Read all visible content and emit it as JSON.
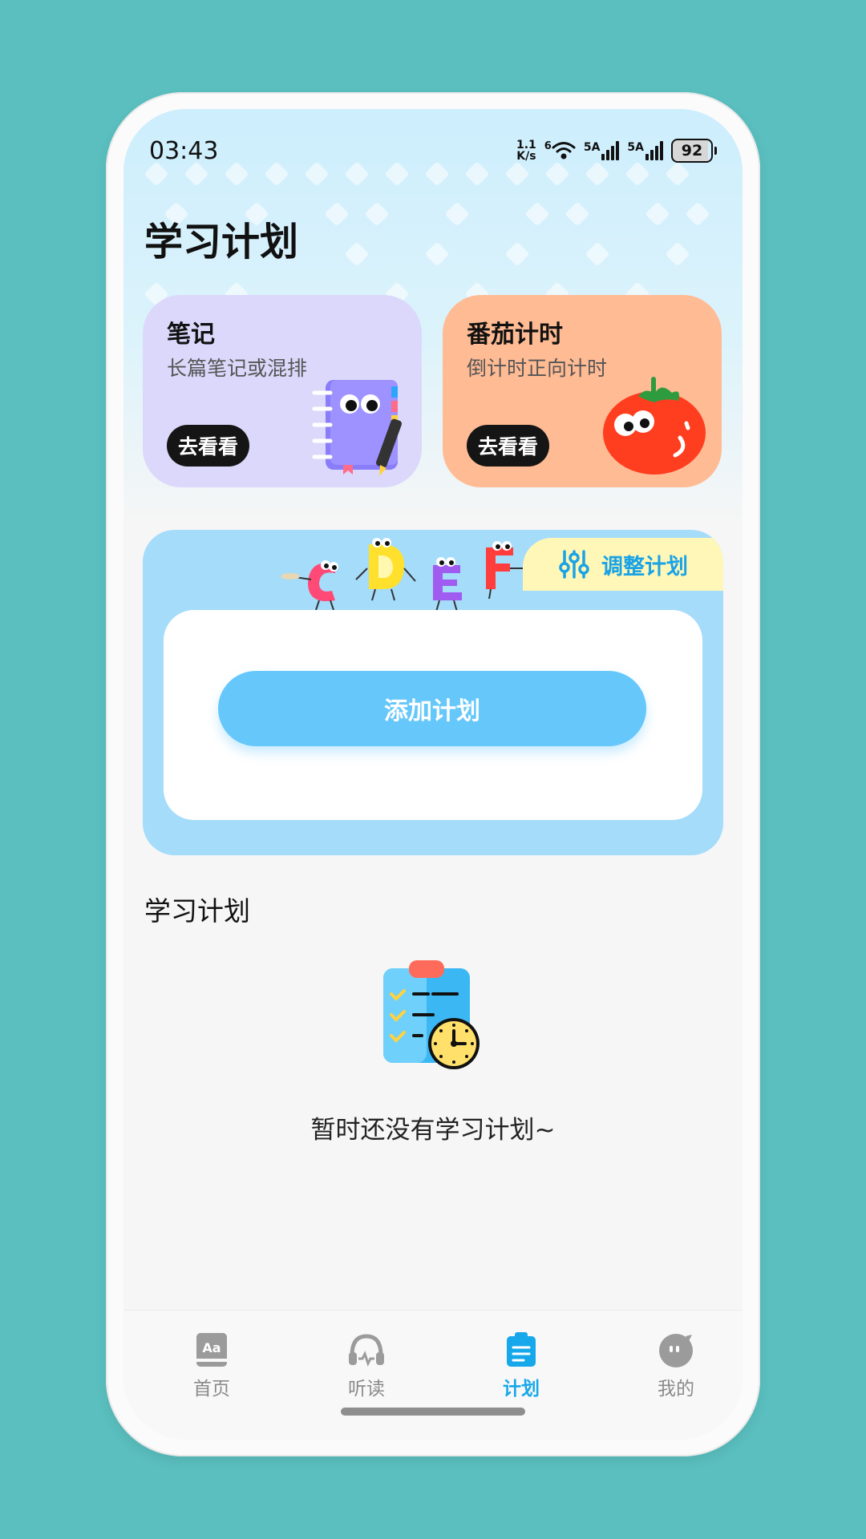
{
  "status_bar": {
    "time": "03:43",
    "net_speed_value": "1.1",
    "net_speed_unit": "K/s",
    "wifi_badge": "6",
    "sim1_label": "5A",
    "sim2_label": "5A",
    "battery": "92"
  },
  "page_title": "学习计划",
  "cards": {
    "notes": {
      "title": "笔记",
      "subtitle": "长篇笔记或混排",
      "button": "去看看"
    },
    "tomato": {
      "title": "番茄计时",
      "subtitle": "倒计时正向计时",
      "button": "去看看"
    }
  },
  "plan_card": {
    "adjust_label": "调整计划",
    "letters": [
      "C",
      "D",
      "E",
      "F"
    ],
    "add_button": "添加计划"
  },
  "section_title": "学习计划",
  "empty_state": {
    "text": "暂时还没有学习计划~"
  },
  "tabbar": {
    "items": [
      {
        "label": "首页",
        "icon": "dictionary-icon"
      },
      {
        "label": "听读",
        "icon": "headphones-icon"
      },
      {
        "label": "计划",
        "icon": "clipboard-icon",
        "active": true
      },
      {
        "label": "我的",
        "icon": "profile-face-icon"
      }
    ]
  },
  "colors": {
    "accent": "#16a8ea",
    "plan_card_bg": "#a4dcfa",
    "notes_card_bg": "#dcd8fb",
    "tomato_card_bg": "#ffbb94",
    "add_button_bg": "#66c7fb"
  }
}
